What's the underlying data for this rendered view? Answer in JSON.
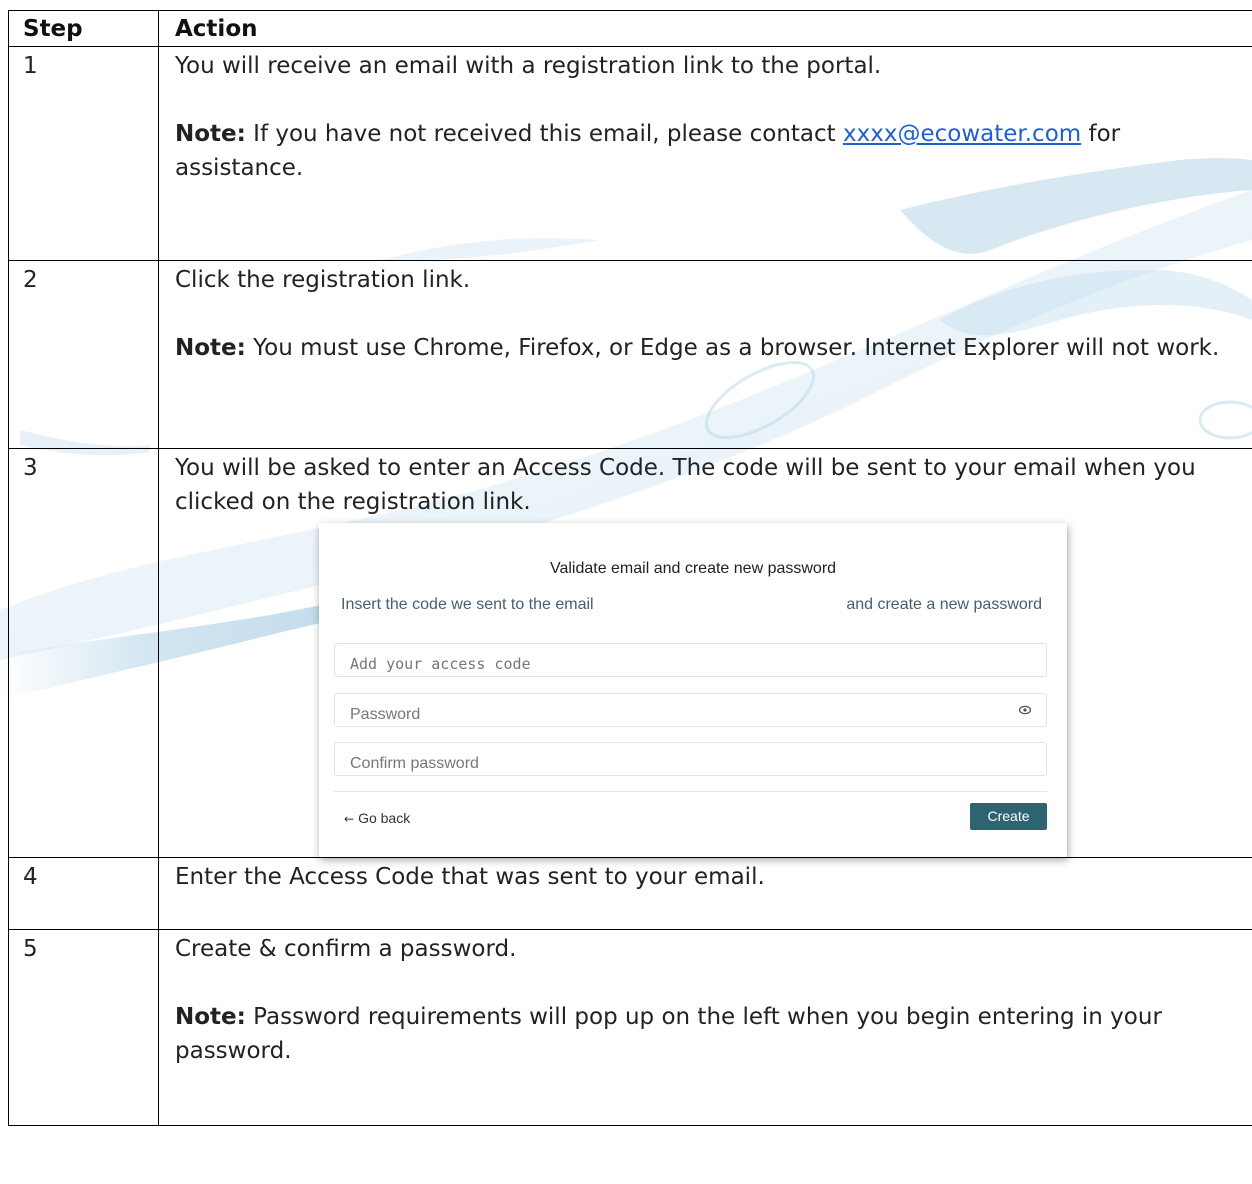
{
  "table": {
    "headers": {
      "step": "Step",
      "action": "Action"
    },
    "rows": [
      {
        "step": "1",
        "text": "You will receive an email with a registration link to the portal.",
        "note_label": "Note:",
        "note_before_link": " If you have not received this email, please contact ",
        "note_link": "xxxx@ecowater.com",
        "note_after_link": " for assistance."
      },
      {
        "step": "2",
        "text": "Click the registration link.",
        "note_label": "Note:",
        "note_text": " You must use Chrome, Firefox, or Edge as a browser. Internet Explorer will not work."
      },
      {
        "step": "3",
        "text": "You will be asked to enter an Access Code. The code will be sent to your email when you clicked on the registration link."
      },
      {
        "step": "4",
        "text": "Enter the Access Code that was sent to your email."
      },
      {
        "step": "5",
        "text": "Create & confirm a password.",
        "note_label": "Note:",
        "note_text": " Password requirements will pop up on the left when you begin entering in your password."
      }
    ]
  },
  "form": {
    "title": "Validate email and create new password",
    "subtitle_left": "Insert the code we sent to the email",
    "subtitle_right": "and create a new password",
    "access_code_placeholder": "Add your access code",
    "password_placeholder": "Password",
    "confirm_placeholder": "Confirm password",
    "back_arrow": "←",
    "back_label": "Go back",
    "create_label": "Create",
    "eye_icon": "eye-icon",
    "back_icon": "arrow-left-icon"
  },
  "colors": {
    "link": "#1f5fd0",
    "button": "#2e6470",
    "subtitle": "#4a5d6e",
    "border": "#000000"
  }
}
